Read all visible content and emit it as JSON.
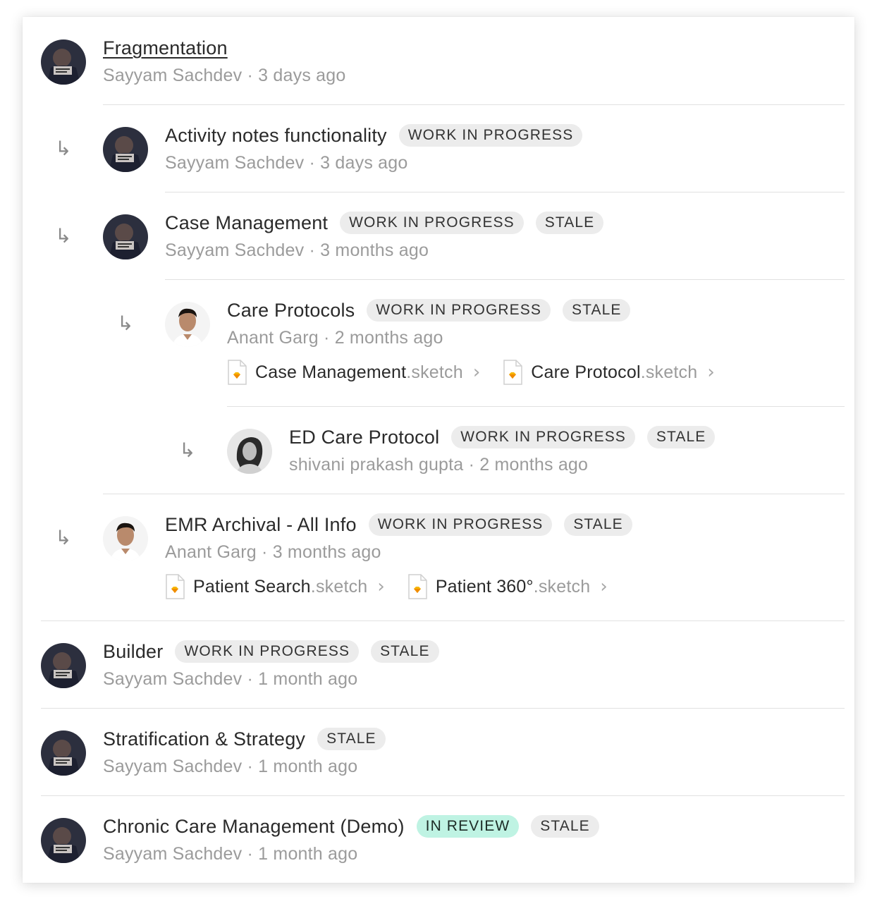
{
  "items": [
    {
      "title": "Fragmentation",
      "author": "Sayyam Sachdev",
      "time": "3 days ago",
      "badges": []
    },
    {
      "title": "Activity notes functionality",
      "author": "Sayyam Sachdev",
      "time": "3 days ago",
      "badges": [
        "WORK IN PROGRESS"
      ]
    },
    {
      "title": "Case Management",
      "author": "Sayyam Sachdev",
      "time": "3 months ago",
      "badges": [
        "WORK IN PROGRESS",
        "STALE"
      ]
    },
    {
      "title": "Care Protocols",
      "author": "Anant Garg",
      "time": "2 months ago",
      "badges": [
        "WORK IN PROGRESS",
        "STALE"
      ],
      "files": [
        {
          "name": "Case Management",
          "ext": ".sketch"
        },
        {
          "name": "Care Protocol",
          "ext": ".sketch"
        }
      ]
    },
    {
      "title": "ED Care Protocol",
      "author": "shivani prakash gupta",
      "time": "2 months ago",
      "badges": [
        "WORK IN PROGRESS",
        "STALE"
      ]
    },
    {
      "title": "EMR Archival - All Info",
      "author": "Anant Garg",
      "time": "3 months ago",
      "badges": [
        "WORK IN PROGRESS",
        "STALE"
      ],
      "files": [
        {
          "name": "Patient Search",
          "ext": ".sketch"
        },
        {
          "name": "Patient 360°",
          "ext": ".sketch"
        }
      ]
    },
    {
      "title": "Builder",
      "author": "Sayyam Sachdev",
      "time": "1 month ago",
      "badges": [
        "WORK IN PROGRESS",
        "STALE"
      ]
    },
    {
      "title": "Stratification & Strategy",
      "author": "Sayyam Sachdev",
      "time": "1 month ago",
      "badges": [
        "STALE"
      ]
    },
    {
      "title": "Chronic Care Management (Demo)",
      "author": "Sayyam Sachdev",
      "time": "1 month ago",
      "badges": [
        "IN REVIEW",
        "STALE"
      ]
    }
  ],
  "meta_separator": " · ",
  "child_arrow_glyph": "↳",
  "chevron_glyph": "›",
  "icons": {
    "avatar": "user-avatar",
    "arrow": "child-arrow-icon",
    "file": "sketch-file-icon",
    "chevron": "chevron-right-icon"
  },
  "colors": {
    "badge_default": "#ececec",
    "badge_review": "#bff3e3",
    "meta_text": "#9b9b9b",
    "sketch_orange": "#f7b500"
  }
}
